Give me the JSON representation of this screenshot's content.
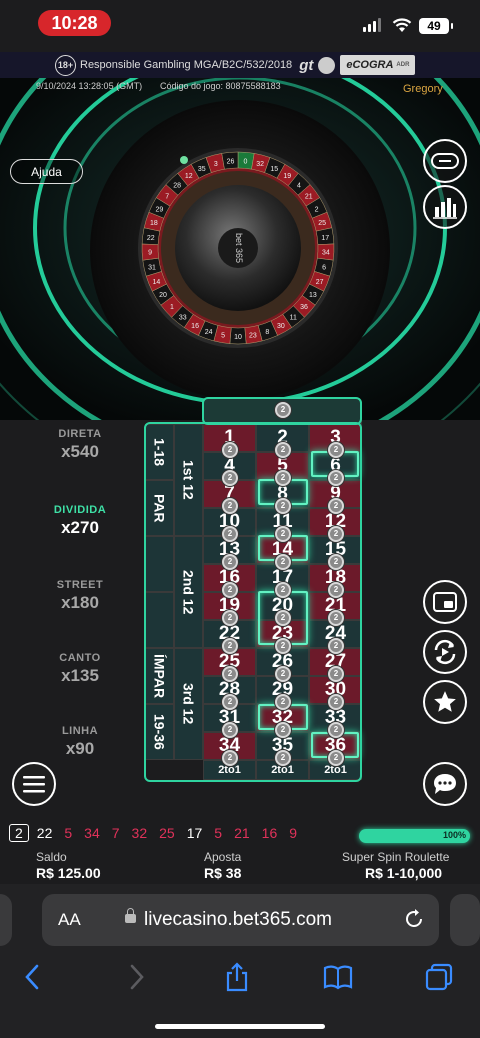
{
  "status_bar": {
    "time": "10:28",
    "battery": "49"
  },
  "regulatory": {
    "age_badge": "18+",
    "text": "Responsible Gambling MGA/B2C/532/2018",
    "gt_logo": "gt",
    "ecogra": "eCOGRA",
    "ecogra_small": "ADR"
  },
  "game_header": {
    "datetime": "9/10/2024 13:28:05 (GMT)",
    "game_code": "Código do jogo: 80875588183",
    "dealer": "Gregory",
    "help_label": "Ajuda",
    "wheel_logo": "bet 365"
  },
  "payouts": [
    {
      "label": "DIRETA",
      "value": "x540",
      "active": false
    },
    {
      "label": "DIVIDIDA",
      "value": "x270",
      "active": true
    },
    {
      "label": "STREET",
      "value": "x180",
      "active": false
    },
    {
      "label": "CANTO",
      "value": "x135",
      "active": false
    },
    {
      "label": "LINHA",
      "value": "x90",
      "active": false
    }
  ],
  "table": {
    "rows": [
      [
        1,
        2,
        3
      ],
      [
        4,
        5,
        6
      ],
      [
        7,
        8,
        9
      ],
      [
        10,
        11,
        12
      ],
      [
        13,
        14,
        15
      ],
      [
        16,
        17,
        18
      ],
      [
        19,
        20,
        21
      ],
      [
        22,
        23,
        24
      ],
      [
        25,
        26,
        27
      ],
      [
        28,
        29,
        30
      ],
      [
        31,
        32,
        33
      ],
      [
        34,
        35,
        36
      ]
    ],
    "red_numbers": [
      1,
      3,
      5,
      7,
      9,
      12,
      14,
      16,
      18,
      19,
      21,
      23,
      25,
      27,
      30,
      32,
      34,
      36
    ],
    "dozens": [
      "1st 12",
      "2nd 12",
      "3rd 12"
    ],
    "outside": [
      "1-18",
      "PAR",
      "",
      "",
      "ÍMPAR",
      "19-36"
    ],
    "columns": [
      "2to1",
      "2to1",
      "2to1"
    ],
    "chip_value": "2"
  },
  "history": {
    "items": [
      {
        "n": "2",
        "color": "white"
      },
      {
        "n": "22",
        "color": "white"
      },
      {
        "n": "5",
        "color": "red"
      },
      {
        "n": "34",
        "color": "red"
      },
      {
        "n": "7",
        "color": "red"
      },
      {
        "n": "32",
        "color": "red"
      },
      {
        "n": "25",
        "color": "red"
      },
      {
        "n": "17",
        "color": "white"
      },
      {
        "n": "5",
        "color": "red"
      },
      {
        "n": "21",
        "color": "red"
      },
      {
        "n": "16",
        "color": "red"
      },
      {
        "n": "9",
        "color": "red"
      }
    ],
    "progress": 1.0,
    "progress_label": "100%"
  },
  "stats": {
    "balance_label": "Saldo",
    "balance_value": "R$ 125.00",
    "bet_label": "Aposta",
    "bet_value": "R$ 38",
    "game_label": "Super Spin Roulette",
    "game_value": "R$ 1-10,000"
  },
  "browser": {
    "aa": "AA",
    "url": "livecasino.bet365.com"
  },
  "colors": {
    "accent": "#2fd4a0",
    "red": "#6c1a2a",
    "black": "#1d3537",
    "hist_red": "#e0325a"
  }
}
